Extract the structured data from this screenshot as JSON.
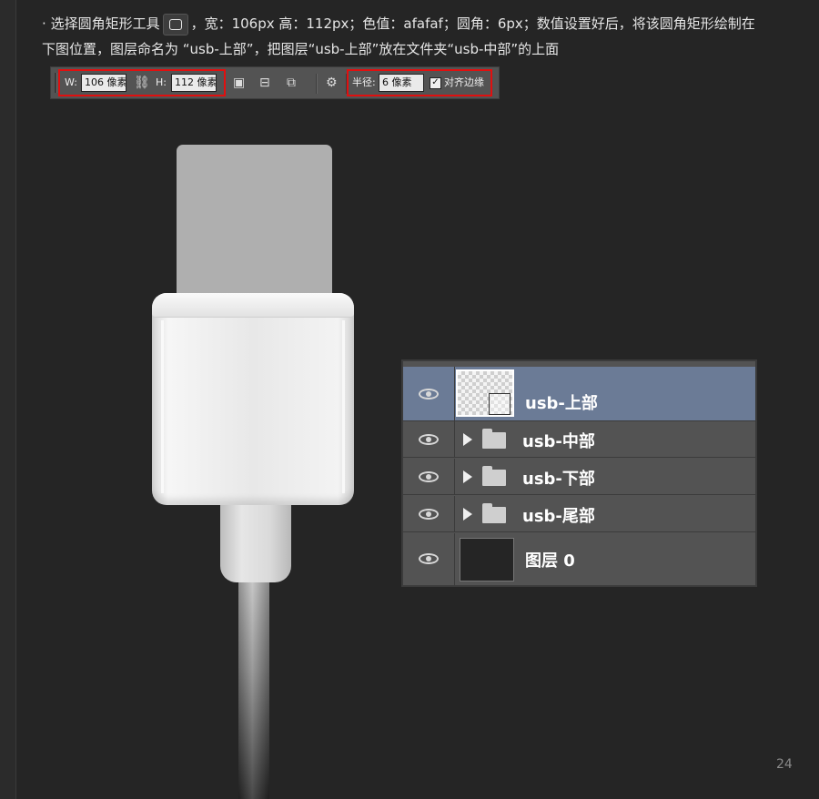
{
  "instruction": {
    "bullet": "·",
    "line1_part1": "选择圆角矩形工具",
    "line1_part2": "，宽：106px 高：112px；色值：afafaf；圆角：6px；数值设置好后，将该圆角矩形绘制在",
    "line2": "下图位置，图层命名为 “usb-上部”，把图层“usb-上部”放在文件夹“usb-中部”的上面",
    "tool_icon": "rounded-rectangle-tool-icon"
  },
  "options_bar": {
    "w_label": "W:",
    "w_value": "106 像素",
    "link_icon": "link-icon",
    "h_label": "H:",
    "h_value": "112 像素",
    "radius_label": "半径:",
    "radius_value": "6 像素",
    "align_edges_label": "对齐边缘",
    "align_edges_checked": true,
    "highlight_color": "#e10f0f"
  },
  "layers": [
    {
      "name": "usb-上部",
      "type": "shape",
      "selected": true
    },
    {
      "name": "usb-中部",
      "type": "folder",
      "selected": false
    },
    {
      "name": "usb-下部",
      "type": "folder",
      "selected": false
    },
    {
      "name": "usb-尾部",
      "type": "folder",
      "selected": false
    },
    {
      "name": "图层 0",
      "type": "layer",
      "selected": false
    }
  ],
  "colors": {
    "background": "#252525",
    "usb_top_fill": "#afafaf",
    "selected_layer": "#6b7b96"
  },
  "page_number": "24"
}
